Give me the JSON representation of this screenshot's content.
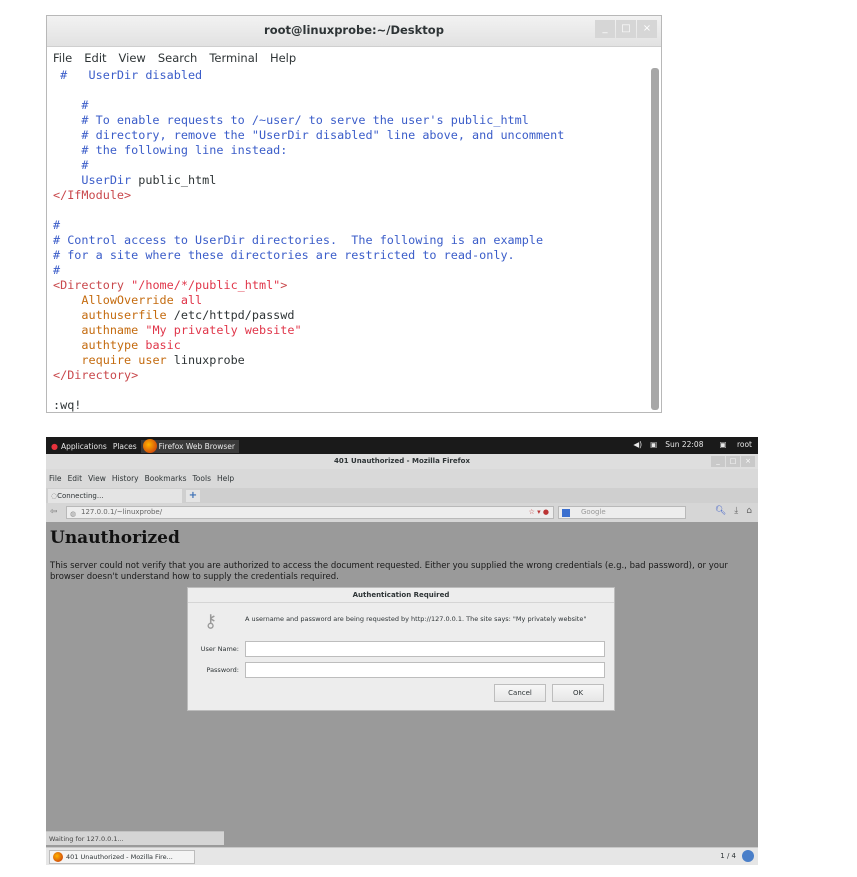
{
  "terminal": {
    "title": "root@linuxprobe:~/Desktop",
    "menu": [
      "File",
      "Edit",
      "View",
      "Search",
      "Terminal",
      "Help"
    ],
    "lines": [
      [
        {
          "t": " #   UserDir disabled",
          "c": "c"
        }
      ],
      [],
      [
        {
          "t": "    #",
          "c": "c"
        }
      ],
      [
        {
          "t": "    # To enable requests to /~user/ to serve the user's public_html",
          "c": "c"
        }
      ],
      [
        {
          "t": "    # directory, remove the \"UserDir disabled\" line above, and uncomment",
          "c": "c"
        }
      ],
      [
        {
          "t": "    # the following line instead:",
          "c": "c"
        }
      ],
      [
        {
          "t": "    #",
          "c": "c"
        }
      ],
      [
        {
          "t": "    UserDir",
          "c": "c"
        },
        {
          "t": " public_html",
          "c": ""
        }
      ],
      [
        {
          "t": "</IfModule>",
          "c": "t"
        }
      ],
      [],
      [
        {
          "t": "#",
          "c": "c"
        }
      ],
      [
        {
          "t": "# Control access to UserDir directories.  The following is an example",
          "c": "c"
        }
      ],
      [
        {
          "t": "# for a site where these directories are restricted to read-only.",
          "c": "c"
        }
      ],
      [
        {
          "t": "#",
          "c": "c"
        }
      ],
      [
        {
          "t": "<Directory ",
          "c": "t"
        },
        {
          "t": "\"/home/*/public_html\"",
          "c": "s"
        },
        {
          "t": ">",
          "c": "t"
        }
      ],
      [
        {
          "t": "    AllowOverride ",
          "c": "a"
        },
        {
          "t": "all",
          "c": "s"
        }
      ],
      [
        {
          "t": "    authuserfile ",
          "c": "a"
        },
        {
          "t": "/etc/httpd/passwd",
          "c": ""
        }
      ],
      [
        {
          "t": "    authname ",
          "c": "a"
        },
        {
          "t": "\"My privately website\"",
          "c": "s"
        }
      ],
      [
        {
          "t": "    authtype ",
          "c": "a"
        },
        {
          "t": "basic",
          "c": "s"
        }
      ],
      [
        {
          "t": "    require ",
          "c": "a"
        },
        {
          "t": "user ",
          "c": "a"
        },
        {
          "t": "linuxprobe",
          "c": ""
        }
      ],
      [
        {
          "t": "</Directory>",
          "c": "t"
        }
      ],
      [],
      [
        {
          "t": ":wq!",
          "c": ""
        }
      ]
    ]
  },
  "topbar": {
    "applications": "Applications",
    "places": "Places",
    "active_app": "Firefox Web Browser",
    "clock": "Sun 22:08",
    "user": "root",
    "volume_icon": "volume-icon",
    "network_icon": "network-icon"
  },
  "firefox": {
    "window_title": "401 Unauthorized - Mozilla Firefox",
    "menu": [
      "File",
      "Edit",
      "View",
      "History",
      "Bookmarks",
      "Tools",
      "Help"
    ],
    "tab_label": "Connecting...",
    "url": "127.0.0.1/~linuxprobe/",
    "search_placeholder": "Google",
    "page": {
      "heading": "Unauthorized",
      "text": "This server could not verify that you are authorized to access the document requested. Either you supplied the wrong credentials (e.g., bad password), or your browser doesn't understand how to supply the credentials required."
    },
    "dialog": {
      "title": "Authentication Required",
      "message": "A username and password are being requested by http://127.0.0.1. The site says: \"My privately website\"",
      "username_label": "User Name:",
      "password_label": "Password:",
      "cancel_label": "Cancel",
      "ok_label": "OK"
    },
    "status": "Waiting for 127.0.0.1..."
  },
  "taskbar": {
    "item_label": "401 Unauthorized - Mozilla Fire...",
    "workspace": "1 / 4"
  }
}
